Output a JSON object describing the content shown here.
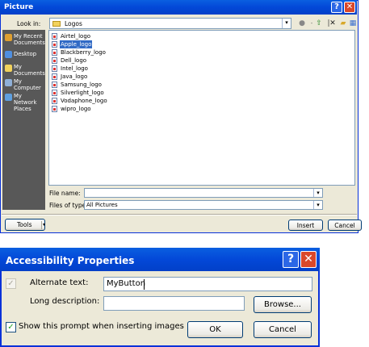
{
  "picture_dialog": {
    "title": "Picture",
    "look_in_label": "Look in:",
    "look_in_value": "Logos",
    "places": [
      {
        "label": "My Recent Documents",
        "icon": "recent-icon",
        "color": "#e0a030"
      },
      {
        "label": "Desktop",
        "icon": "desktop-icon",
        "color": "#4f8fe0"
      },
      {
        "label": "My Documents",
        "icon": "documents-icon",
        "color": "#f2d25c"
      },
      {
        "label": "My Computer",
        "icon": "computer-icon",
        "color": "#8fb0d8"
      },
      {
        "label": "My Network Places",
        "icon": "network-icon",
        "color": "#5fa0e0"
      }
    ],
    "files": [
      {
        "name": "Airtel_logo",
        "selected": false
      },
      {
        "name": "Apple_logo",
        "selected": true
      },
      {
        "name": "Blackberry_logo",
        "selected": false
      },
      {
        "name": "Dell_logo",
        "selected": false
      },
      {
        "name": "Intel_logo",
        "selected": false
      },
      {
        "name": "Java_logo",
        "selected": false
      },
      {
        "name": "Samsung_logo",
        "selected": false
      },
      {
        "name": "Silverlight_logo",
        "selected": false
      },
      {
        "name": "Vodaphone_logo",
        "selected": false
      },
      {
        "name": "wipro_logo",
        "selected": false
      }
    ],
    "file_name_label": "File name:",
    "file_name_value": "",
    "files_of_type_label": "Files of type:",
    "files_of_type_value": "All Pictures",
    "tools_label": "Tools",
    "insert_label": "Insert",
    "cancel_label": "Cancel"
  },
  "accessibility_dialog": {
    "title": "Accessibility Properties",
    "alternate_text_label": "Alternate text:",
    "alternate_text_value": "MyButton",
    "long_description_label": "Long description:",
    "long_description_value": "",
    "browse_label": "Browse...",
    "show_prompt_label": "Show this prompt when inserting images",
    "show_prompt_checked": true,
    "ok_label": "OK",
    "cancel_label": "Cancel"
  }
}
